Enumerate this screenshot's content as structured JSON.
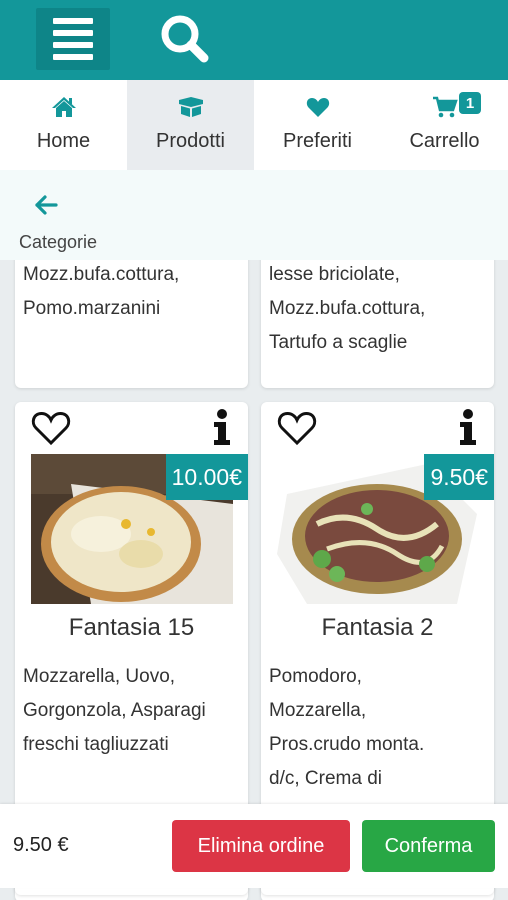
{
  "header": {
    "menu_icon": "hamburger-icon",
    "search_icon": "search-icon",
    "accent": "#13979a"
  },
  "nav": {
    "items": [
      {
        "label": "Home",
        "icon": "home-icon"
      },
      {
        "label": "Prodotti",
        "icon": "box-icon",
        "active": true
      },
      {
        "label": "Preferiti",
        "icon": "heart-icon"
      },
      {
        "label": "Carrello",
        "icon": "cart-icon",
        "badge": "1"
      }
    ]
  },
  "categories": {
    "back_icon": "arrow-left-icon",
    "label": "Categorie"
  },
  "products": {
    "top_left_desc": [
      "Mozz.bufa.cottura,",
      "Pomo.marzanini"
    ],
    "top_right_desc": [
      "lesse briciolate,",
      "Mozz.bufa.cottura,",
      "Tartufo a scaglie"
    ],
    "items": [
      {
        "name": "Fantasia 15",
        "price": "10.00€",
        "desc": [
          "Mozzarella, Uovo,",
          "Gorgonzola, Asparagi",
          "freschi tagliuzzati"
        ]
      },
      {
        "name": "Fantasia 2",
        "price": "9.50€",
        "desc": [
          "Pomodoro,",
          "Mozzarella,",
          "Pros.crudo monta.",
          "d/c, Crema di"
        ]
      }
    ]
  },
  "footer": {
    "total": "9.50 €",
    "delete_label": "Elimina ordine",
    "confirm_label": "Conferma",
    "delete_color": "#dc3545",
    "confirm_color": "#28a745"
  }
}
